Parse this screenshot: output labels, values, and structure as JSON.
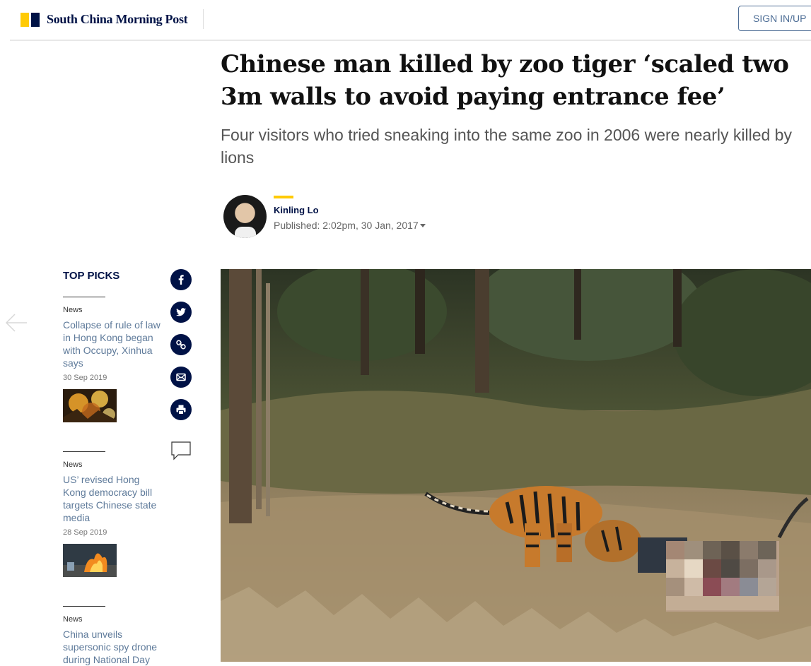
{
  "header": {
    "brand": "South China Morning Post",
    "signin_label": "SIGN IN/UP"
  },
  "article": {
    "headline": "Chinese man killed by zoo tiger ‘scaled two 3m walls to avoid paying entrance fee’",
    "subheadline": "Four visitors who tried sneaking into the same zoo in 2006 were nearly killed by lions",
    "author": "Kinling Lo",
    "published": "Published: 2:02pm, 30 Jan, 2017"
  },
  "top_picks": {
    "title": "TOP PICKS",
    "items": [
      {
        "category": "News",
        "title": "Collapse of rule of law in Hong Kong began with Occupy, Xinhua says",
        "date": "30 Sep 2019"
      },
      {
        "category": "News",
        "title": "US’ revised Hong Kong democracy bill targets Chinese state media",
        "date": "28 Sep 2019"
      },
      {
        "category": "News",
        "title": "China unveils supersonic spy drone during National Day",
        "date": ""
      }
    ]
  },
  "share": {
    "icons": [
      "facebook-icon",
      "twitter-icon",
      "link-icon",
      "email-icon",
      "print-icon",
      "comment-icon"
    ]
  },
  "colors": {
    "brand_navy": "#001246",
    "brand_yellow": "#ffca05",
    "link_blue": "#5e7a9a"
  }
}
